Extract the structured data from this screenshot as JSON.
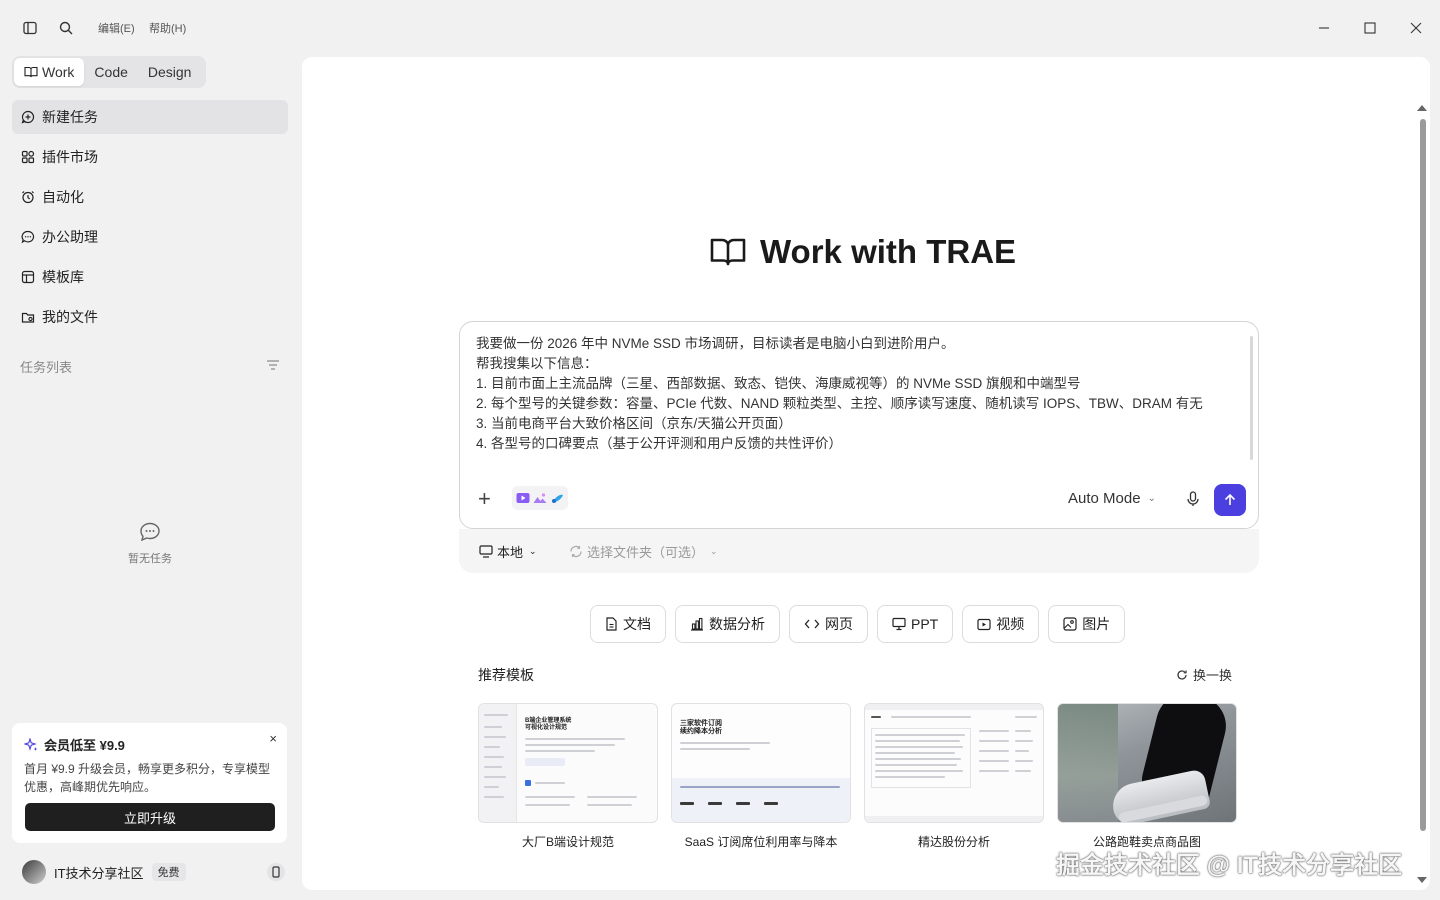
{
  "titlebar": {
    "menu_edit": "编辑(E)",
    "menu_help": "帮助(H)"
  },
  "sidebar": {
    "modes": [
      {
        "label": "Work",
        "active": true
      },
      {
        "label": "Code",
        "active": false
      },
      {
        "label": "Design",
        "active": false
      }
    ],
    "nav": [
      {
        "label": "新建任务",
        "icon": "new-task-icon",
        "active": true
      },
      {
        "label": "插件市场",
        "icon": "plugin-market-icon",
        "active": false
      },
      {
        "label": "自动化",
        "icon": "alarm-clock-icon",
        "active": false
      },
      {
        "label": "办公助理",
        "icon": "chat-bubble-icon",
        "active": false
      },
      {
        "label": "模板库",
        "icon": "template-icon",
        "active": false
      },
      {
        "label": "我的文件",
        "icon": "files-icon",
        "active": false
      }
    ],
    "tasks_heading": "任务列表",
    "empty_text": "暂无任务",
    "promo": {
      "title": "会员低至 ¥9.9",
      "description": "首月 ¥9.9 升级会员，畅享更多积分，专享模型优惠，高峰期优先响应。",
      "button": "立即升级",
      "close": "×"
    },
    "user": {
      "name": "IT技术分享社区",
      "plan": "免费"
    }
  },
  "main": {
    "hero_title": "Work with TRAE",
    "prompt_text": "我要做一份 2026 年中 NVMe SSD 市场调研，目标读者是电脑小白到进阶用户。\n帮我搜集以下信息：\n1. 目前市面上主流品牌（三星、西部数据、致态、铠侠、海康威视等）的 NVMe SSD 旗舰和中端型号\n2. 每个型号的关键参数：容量、PCIe 代数、NAND 颗粒类型、主控、顺序读写速度、随机读写 IOPS、TBW、DRAM 有无\n3. 当前电商平台大致价格区间（京东/天猫公开页面）\n4. 各型号的口碑要点（基于公开评测和用户反馈的共性评价）",
    "mode_label": "Auto Mode",
    "location_label": "本地",
    "folder_label": "选择文件夹（可选）",
    "chips": [
      {
        "label": "文档",
        "icon": "document-icon"
      },
      {
        "label": "数据分析",
        "icon": "bar-chart-icon"
      },
      {
        "label": "网页",
        "icon": "code-brackets-icon"
      },
      {
        "label": "PPT",
        "icon": "presentation-icon"
      },
      {
        "label": "视频",
        "icon": "video-icon"
      },
      {
        "label": "图片",
        "icon": "image-icon"
      }
    ],
    "recommended_heading": "推荐模板",
    "refresh_label": "换一换",
    "templates": [
      {
        "label": "大厂B端设计规范"
      },
      {
        "label": "SaaS 订阅席位利用率与降本"
      },
      {
        "label": "精达股份分析"
      },
      {
        "label": "公路跑鞋卖点商品图"
      }
    ],
    "template_thumb_texts": {
      "t1_heading": "B端企业管理系统\n可视化设计规范",
      "t2_heading": "三家软件订阅\n续约降本分析"
    }
  },
  "watermark": "掘金技术社区 @ IT技术分享社区",
  "colors": {
    "accent": "#4b3fe0",
    "background": "#f1f1f2",
    "panel": "#ffffff",
    "promo_button": "#1f1f1f"
  }
}
